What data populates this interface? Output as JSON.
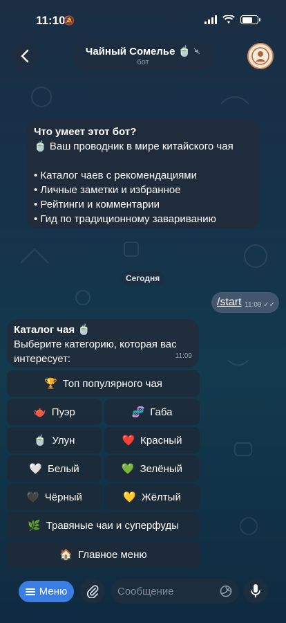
{
  "status_bar": {
    "time": "11:10",
    "mute_icon": "🔕"
  },
  "header": {
    "title": "Чайный Сомелье",
    "title_emoji": "🍵",
    "subtitle": "бот",
    "back_icon": "chevron-left"
  },
  "info_card": {
    "heading": "Что умеет этот бот?",
    "intro": "🍵 Ваш проводник в мире китайского чая",
    "bullets": [
      "• Каталог чаев с рекомендациями",
      "• Личные заметки и избранное",
      "• Рейтинги и комментарии",
      "• Гид по традиционному завариванию"
    ]
  },
  "date_separator": "Сегодня",
  "outgoing_message": {
    "text": "/start",
    "time": "11:09"
  },
  "incoming_message": {
    "heading": "Каталог чая 🍵",
    "line1": "Выберите категорию, которая вас",
    "line2": "интересует:",
    "time": "11:09"
  },
  "keyboard": {
    "top": {
      "emoji": "🏆",
      "label": "Топ популярного чая"
    },
    "puer": {
      "emoji": "🫖",
      "label": "Пуэр"
    },
    "gaba": {
      "emoji": "🧬",
      "label": "Габа"
    },
    "ulun": {
      "emoji": "🍵",
      "label": "Улун"
    },
    "red": {
      "emoji": "❤️",
      "label": "Красный"
    },
    "white": {
      "emoji": "🤍",
      "label": "Белый"
    },
    "green": {
      "emoji": "💚",
      "label": "Зелёный"
    },
    "black": {
      "emoji": "🖤",
      "label": "Чёрный"
    },
    "yellow": {
      "emoji": "💛",
      "label": "Жёлтый"
    },
    "herbal": {
      "emoji": "🌿",
      "label": "Травяные чаи и суперфуды"
    },
    "main_menu": {
      "emoji": "🏠",
      "label": "Главное меню"
    }
  },
  "composer": {
    "menu_label": "Меню",
    "placeholder": "Сообщение"
  },
  "colors": {
    "accent": "#3a7de4",
    "bubble": "#212c3b",
    "outgoing": "#42566e"
  }
}
